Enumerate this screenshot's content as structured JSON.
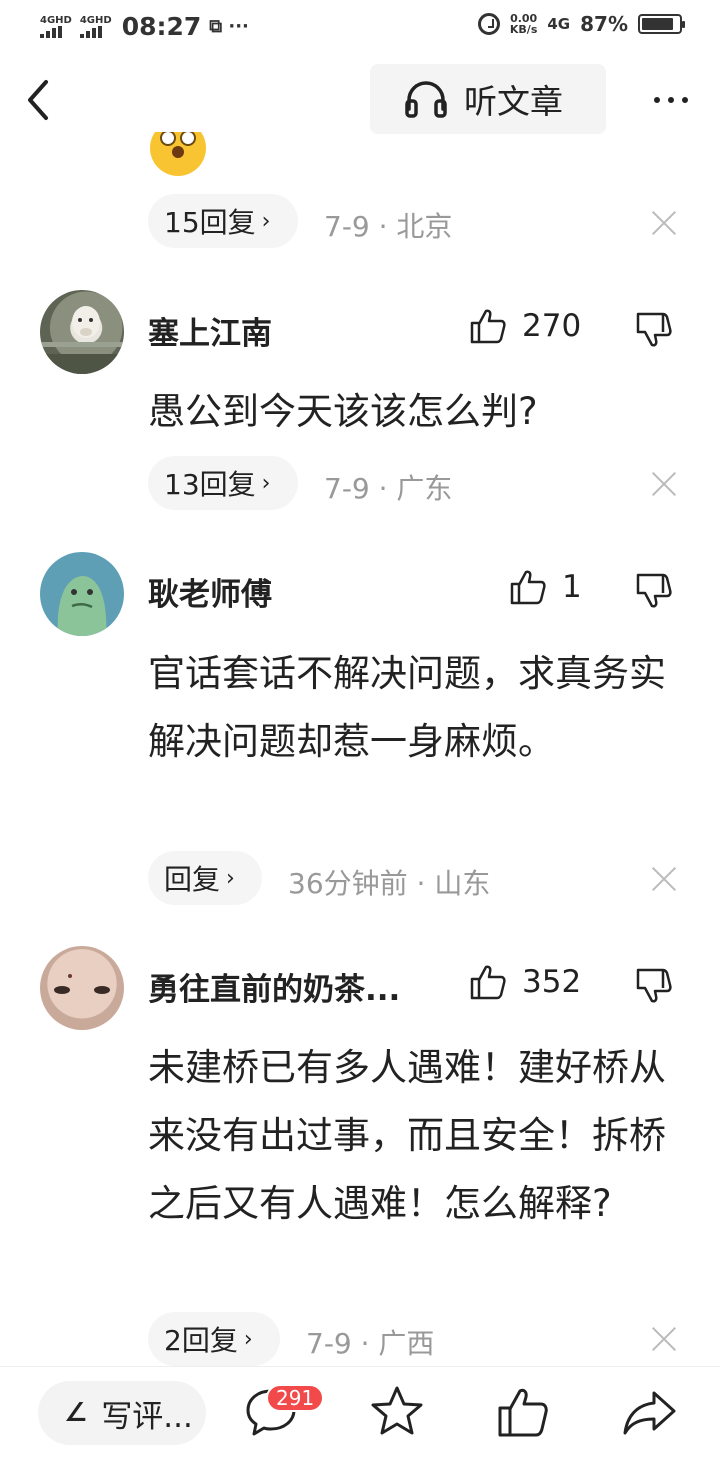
{
  "status_bar": {
    "signal1": "4GHD",
    "signal2": "4GHD",
    "time": "08:27",
    "misc": "⧉ ···",
    "speed_value": "0.00",
    "speed_unit": "KB/s",
    "network": "4G",
    "battery_pct": "87%",
    "battery_level": 0.87
  },
  "nav": {
    "listen_label": "听文章"
  },
  "comments": [
    {
      "reply_label": "15回复",
      "meta": "7-9 · 北京"
    },
    {
      "username": "塞上江南",
      "likes": "270",
      "text": "愚公到今天该该怎么判?",
      "reply_label": "13回复",
      "meta": "7-9 · 广东"
    },
    {
      "username": "耿老师傅",
      "likes": "1",
      "text": "官话套话不解决问题，求真务实解决问题却惹一身麻烦。",
      "reply_label": "回复",
      "meta": "36分钟前 · 山东"
    },
    {
      "username": "勇往直前的奶茶...",
      "likes": "352",
      "text": "未建桥已有多人遇难！建好桥从来没有出过事，而且安全！拆桥之后又有人遇难！怎么解释?",
      "reply_label": "2回复",
      "meta": "7-9 · 广西"
    }
  ],
  "bottom_bar": {
    "write_label": "写评...",
    "comment_count": "291"
  },
  "colors": {
    "text": "#222222",
    "meta": "#999999",
    "badge": "#f24a4a",
    "pill_bg": "#f5f5f5"
  }
}
